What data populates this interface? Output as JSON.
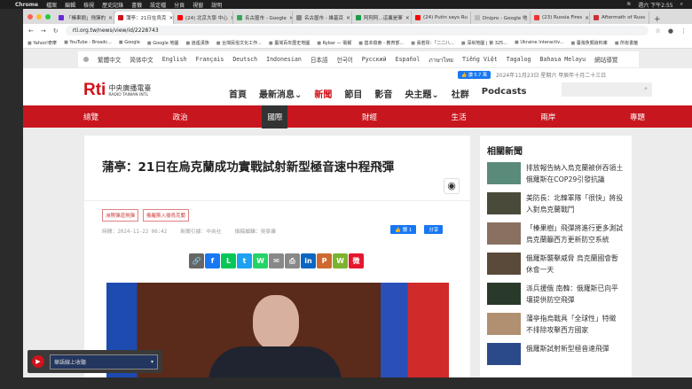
{
  "menubar": {
    "items": [
      "Chrome",
      "檔案",
      "編輯",
      "檢視",
      "歷史記錄",
      "書籤",
      "設定檔",
      "分頁",
      "視窗",
      "說明"
    ],
    "clock": "週六 下午2:55"
  },
  "tabs": [
    {
      "label": "「榛果樹」飛彈的",
      "color": "#6a2bd9"
    },
    {
      "label": "蒲亭：21日在烏克",
      "color": "#d0121b",
      "active": true
    },
    {
      "label": "(24) 北京大學 中心",
      "color": "#f00"
    },
    {
      "label": "名古屋市 - Google",
      "color": "#34a853"
    },
    {
      "label": "名古屋市 - 維基百",
      "color": "#888"
    },
    {
      "label": "阿阿阿...這裏是軍",
      "color": "#1a9a4a"
    },
    {
      "label": "(24) Putin says Ru",
      "color": "#f00"
    },
    {
      "label": "Dnipro - Google 地",
      "color": "#bbb"
    },
    {
      "label": "(23) Russia Fires",
      "color": "#e33"
    },
    {
      "label": "Aftermath of Russ",
      "color": "#c33"
    }
  ],
  "address": {
    "url": "rti.org.tw/news/view/id/2228743"
  },
  "bookmarks": [
    "Yahoo!奇摩",
    "YouTube - Broadc...",
    "Google",
    "Google 地圖",
    "逍遙漢族",
    "台灣民俗文化工作...",
    "臺灣百年歷史地圖",
    "Rybar — 電報",
    "基本檢索 - 教育部...",
    "張若彤：「二二八...",
    "深圳地圖 | 第 325...",
    "Ukraine Interactiv...",
    "臺灣魚類資料庫",
    "所有書籤"
  ],
  "langs": [
    "繁體中文",
    "简体中文",
    "English",
    "Français",
    "Deutsch",
    "Indonesian",
    "日本語",
    "한국어",
    "Русский",
    "Español",
    "ภาษาไทย",
    "Tiếng Việt",
    "Tagalog",
    "Bahasa Melayu",
    "網站導覽"
  ],
  "header": {
    "logo": "Rti",
    "logo_cn": "中央廣播電臺",
    "logo_en": "RADIO TAIWAN INTL",
    "fb_like": "👍 讚 5.7 萬",
    "date": "2024年11月23日 星期六 甲辰年十月二十三日",
    "nav": [
      "首頁",
      "最新消息⌄",
      "新聞",
      "節目",
      "影音",
      "央主題⌄",
      "社群",
      "Podcasts"
    ]
  },
  "rednav": [
    "總覽",
    "政治",
    "國際",
    "財經",
    "生活",
    "兩岸",
    "專題"
  ],
  "article": {
    "title": "蒲亭：21日在烏克蘭成功實戰試射新型極音速中程飛彈",
    "tags": [
      "洲際彈道飛彈",
      "俄羅斯入侵烏克蘭"
    ],
    "time": "時間：2024-11-22 06:42",
    "source": "新聞引據：中央社",
    "editor": "撰稿編輯：吳寧康",
    "like": "👍 讚 1",
    "share": "分享"
  },
  "share_icons": [
    {
      "n": "link",
      "c": "#666",
      "g": "🔗"
    },
    {
      "n": "facebook",
      "c": "#1877f2",
      "g": "f"
    },
    {
      "n": "line",
      "c": "#06c755",
      "g": "L"
    },
    {
      "n": "twitter",
      "c": "#1da1f2",
      "g": "t"
    },
    {
      "n": "whatsapp",
      "c": "#25d366",
      "g": "W"
    },
    {
      "n": "email",
      "c": "#888",
      "g": "✉"
    },
    {
      "n": "print",
      "c": "#888",
      "g": "⎙"
    },
    {
      "n": "linkedin",
      "c": "#0a66c2",
      "g": "in"
    },
    {
      "n": "plurk",
      "c": "#cf682f",
      "g": "P"
    },
    {
      "n": "wechat",
      "c": "#7bb32e",
      "g": "W"
    },
    {
      "n": "weibo",
      "c": "#e6162d",
      "g": "微"
    }
  ],
  "sidebar": {
    "title": "相關新聞",
    "items": [
      "排放報告納入烏克蘭被併吞領土 俄羅斯在COP29引發抗議",
      "美防長：北韓軍隊「很快」將投入對烏克蘭戰鬥",
      "「榛果樹」飛彈將進行更多測試 烏克蘭籲西方更新防空系統",
      "俄羅斯襲擊威脅 烏克蘭國會暫休會一天",
      "派兵援俄 南韓：俄羅斯已向平壤提供防空飛彈",
      "蒲亭指烏戰具「全球性」特徵 不排除攻擊西方國家",
      "俄羅斯試射新型極音速飛彈"
    ]
  },
  "player": {
    "label": "華語線上收聽"
  }
}
